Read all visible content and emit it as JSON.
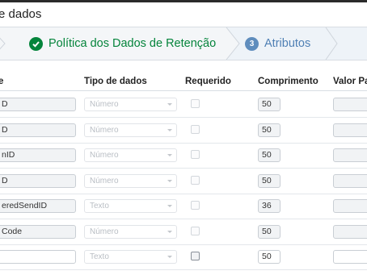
{
  "header": {
    "title": "e dados"
  },
  "wizard": {
    "step2": {
      "label": "Política dos Dados de Retenção",
      "status": "complete"
    },
    "step3": {
      "number": "3",
      "label": "Atributos",
      "status": "active"
    }
  },
  "table": {
    "columns": [
      "e",
      "Tipo de dados",
      "Requerido",
      "Comprimento",
      "Valor Pa"
    ],
    "rows": [
      {
        "name": "D",
        "type": "Número",
        "required": false,
        "length": "50"
      },
      {
        "name": "D",
        "type": "Número",
        "required": false,
        "length": "50"
      },
      {
        "name": "nID",
        "type": "Número",
        "required": false,
        "length": "50"
      },
      {
        "name": "D",
        "type": "Número",
        "required": false,
        "length": "50"
      },
      {
        "name": "eredSendID",
        "type": "Texto",
        "required": false,
        "length": "36"
      },
      {
        "name": "Code",
        "type": "Número",
        "required": false,
        "length": "50"
      },
      {
        "name": "",
        "type": "Texto",
        "required": false,
        "length": "50"
      }
    ]
  },
  "colors": {
    "success": "#04843b",
    "active": "#4e7fb4"
  }
}
